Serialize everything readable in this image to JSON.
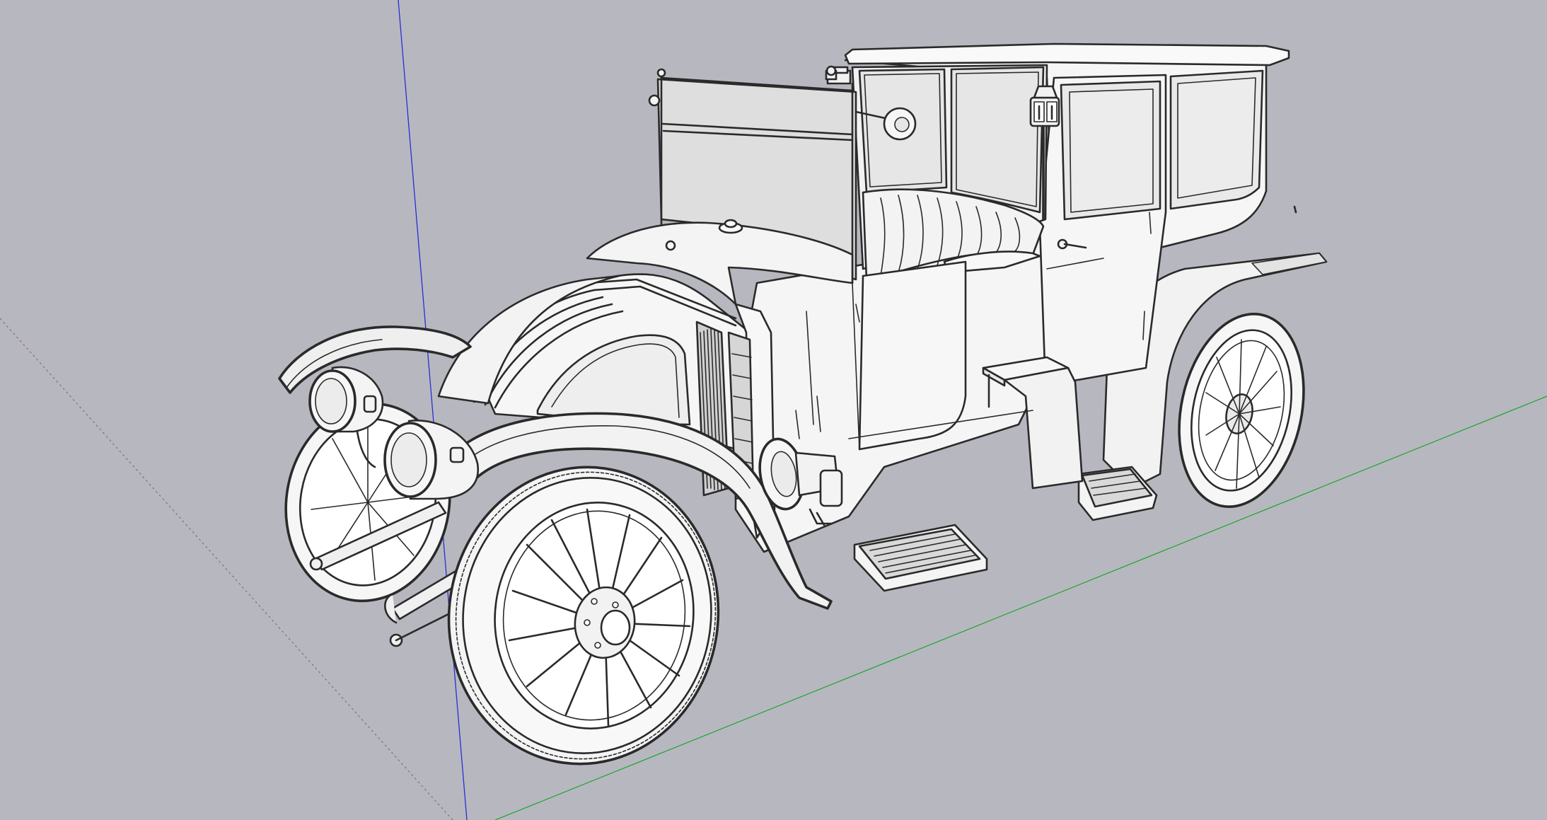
{
  "viewport": {
    "background": "#b7b8bf",
    "axes": {
      "blue_axis_color": "#2b2bd6",
      "green_axis_color": "#27a63a",
      "red_axis_color": "#c84a4a"
    }
  },
  "model": {
    "name_icon": "vintage-landaulet-car-model",
    "face_color": "#f4f4f4",
    "shade_color": "#dcdcdc",
    "edge_color": "#2a2a2a"
  }
}
